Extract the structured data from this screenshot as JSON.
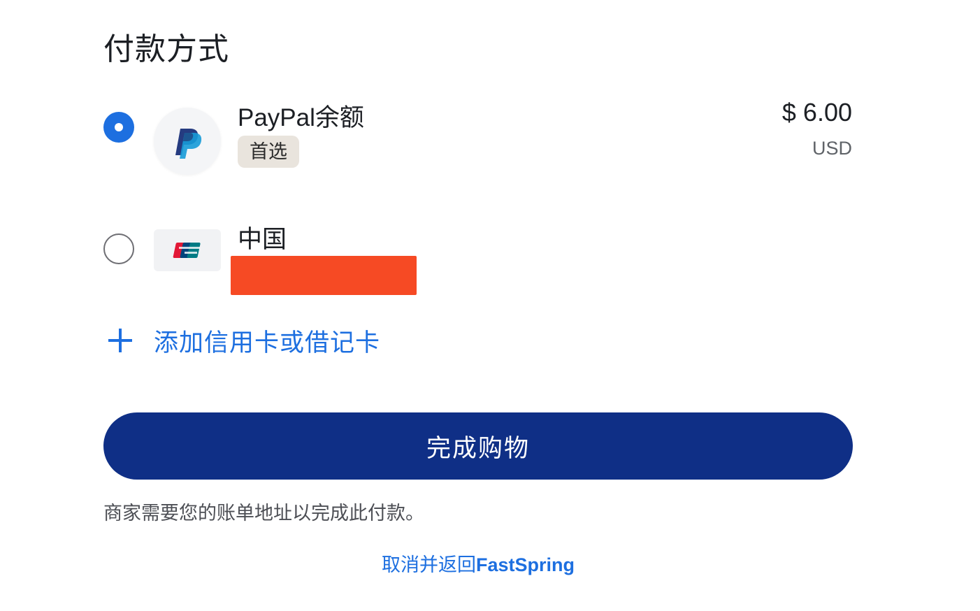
{
  "page": {
    "title": "付款方式"
  },
  "methods": [
    {
      "name": "PayPal余额",
      "badge": "首选",
      "amount": "$ 6.00",
      "currency": "USD",
      "selected": true,
      "icon": "paypal-icon"
    },
    {
      "name": "中国",
      "selected": false,
      "icon": "unionpay-icon"
    }
  ],
  "add_card": {
    "label": "添加信用卡或借记卡",
    "icon": "plus-icon"
  },
  "complete_button": {
    "label": "完成购物"
  },
  "notice": "商家需要您的账单地址以完成此付款。",
  "cancel": {
    "prefix": "取消并返回",
    "brand": "FastSpring"
  },
  "colors": {
    "primary_blue": "#1d6fe0",
    "button_navy": "#0f2f86",
    "redaction": "#f64a24",
    "badge_bg": "#e9e4dd"
  }
}
